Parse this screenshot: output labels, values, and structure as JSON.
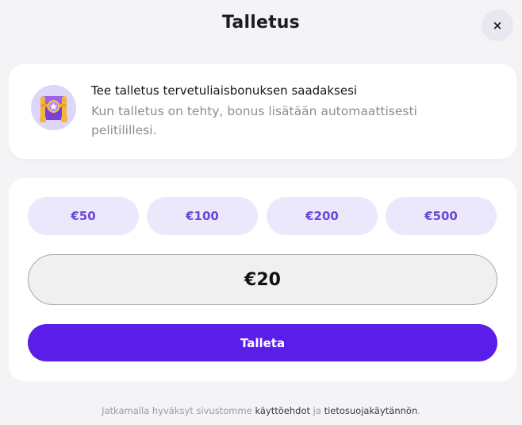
{
  "header": {
    "title": "Talletus",
    "close_glyph": "×"
  },
  "bonus": {
    "icon": "treasure-chest-icon",
    "title": "Tee talletus tervetuliaisbonuksen saadaksesi",
    "description": "Kun talletus on tehty, bonus lisätään automaattisesti pelitilillesi."
  },
  "deposit": {
    "presets": [
      "€50",
      "€100",
      "€200",
      "€500"
    ],
    "amount_value": "€20",
    "submit_label": "Talleta"
  },
  "footer": {
    "prefix": "Jatkamalla hyväksyt sivustomme ",
    "terms_link": "käyttöehdot",
    "conjunction": " ja ",
    "privacy_link": "tietosuojakäytännön",
    "suffix": "."
  },
  "colors": {
    "background": "#f4f4f7",
    "chip_background": "#ece8fc",
    "chip_text": "#6a47d6",
    "primary": "#5a1ee8"
  }
}
